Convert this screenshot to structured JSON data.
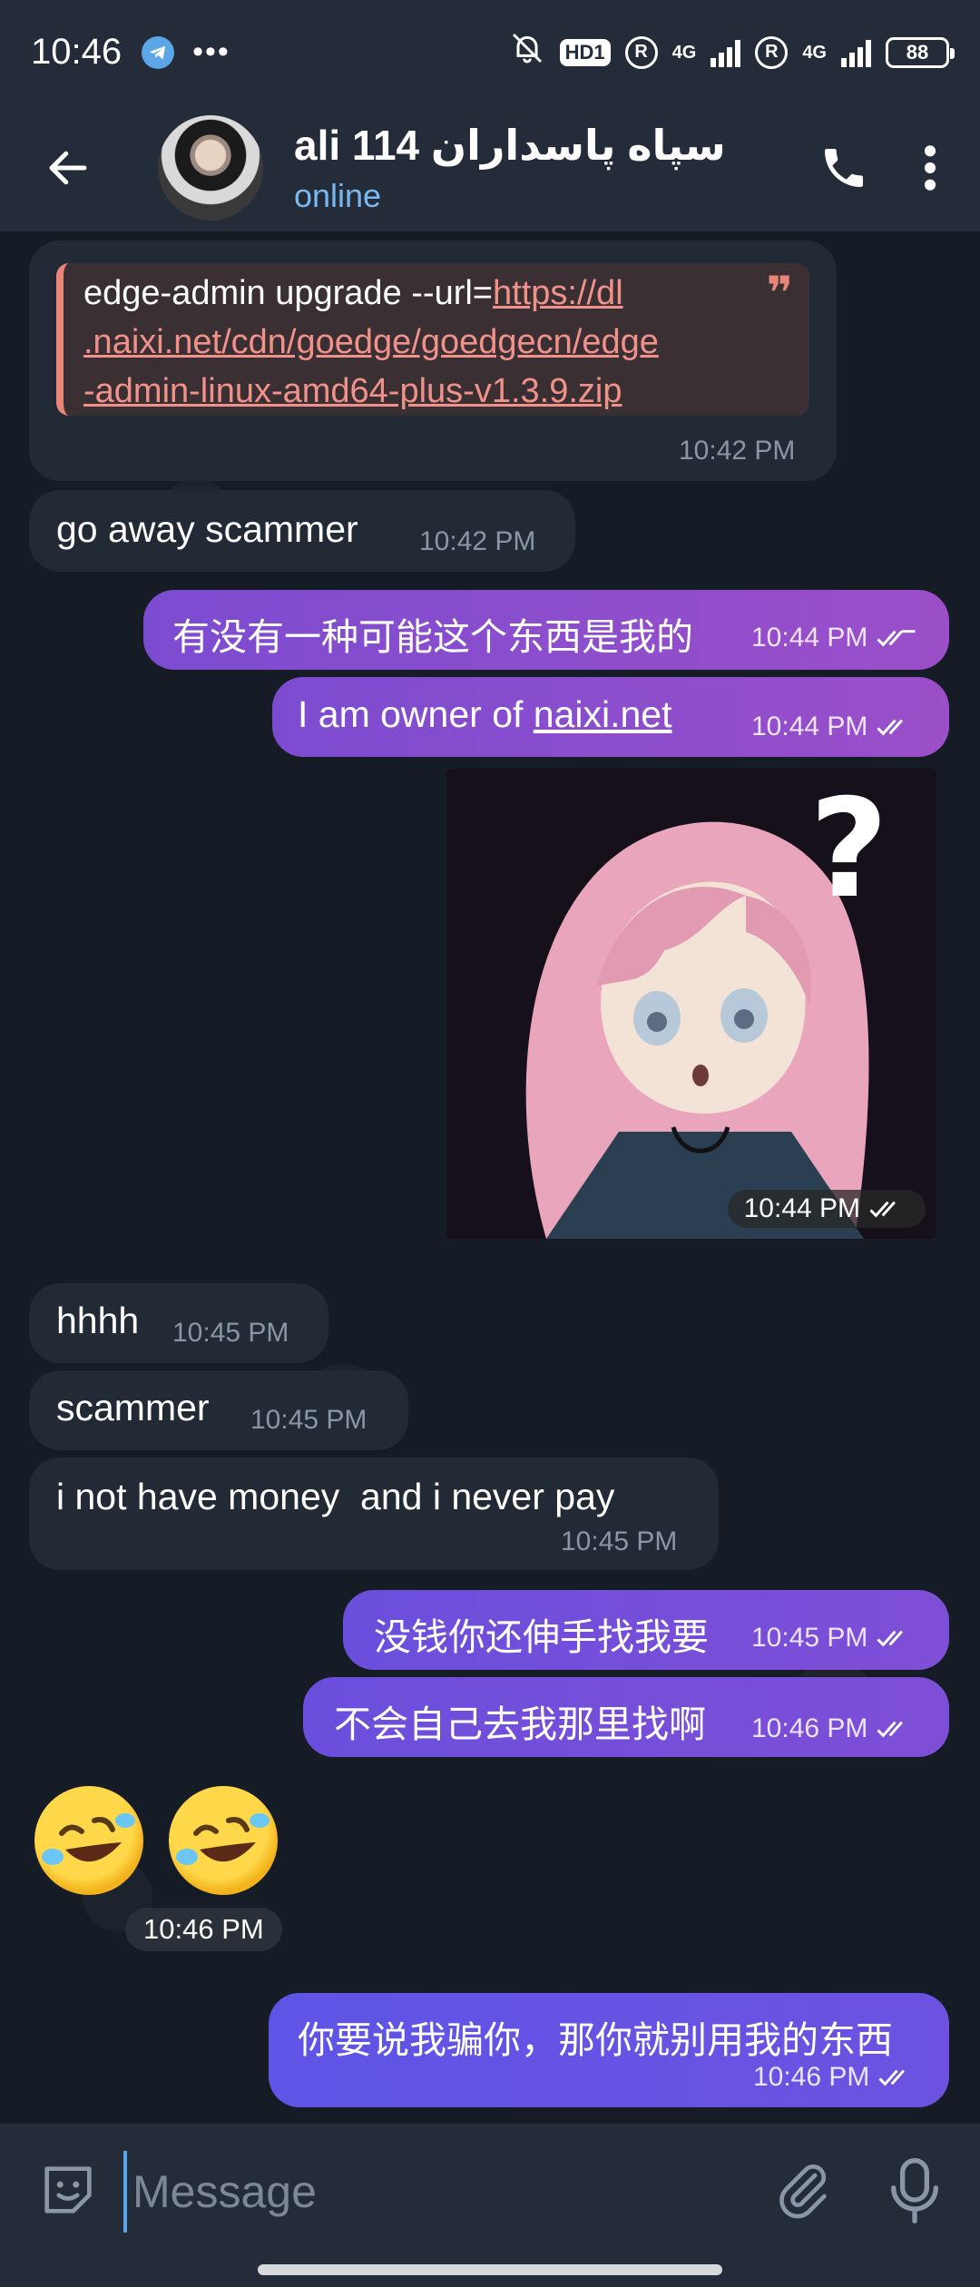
{
  "status_bar": {
    "time": "10:46",
    "hd_badge": "HD1",
    "net1": "4G",
    "net2": "4G",
    "battery": "88"
  },
  "header": {
    "title": "ali 114 سپاه پاسداران",
    "status": "online"
  },
  "messages": [
    {
      "quote_prefix": "edge-admin upgrade --url=",
      "quote_link_1": "https://dl",
      "quote_link_2": ".naixi.net/cdn/goedge/goedgecn/edge",
      "quote_link_3": "-admin-linux-amd64-plus-v1.3.9.zip",
      "time": "10:42 PM"
    },
    {
      "text": "go away scammer",
      "time": "10:42 PM"
    },
    {
      "text": "有没有一种可能这个东西是我的",
      "time": "10:44 PM"
    },
    {
      "text_prefix": "I am owner of ",
      "link": "naixi.net",
      "time": "10:44 PM"
    },
    {
      "sticker": "confused-anime-girl",
      "time": "10:44 PM"
    },
    {
      "text": "hhhh",
      "time": "10:45 PM"
    },
    {
      "text": "scammer",
      "time": "10:45 PM"
    },
    {
      "text": "i not have money  and i never pay",
      "time": "10:45 PM"
    },
    {
      "text": "没钱你还伸手找我要",
      "time": "10:45 PM"
    },
    {
      "text": "不会自己去我那里找啊",
      "time": "10:46 PM"
    },
    {
      "emoji": "rolling-on-floor-laughing",
      "time": "10:46 PM"
    },
    {
      "text": "你要说我骗你，那你就别用我的东西",
      "time": "10:46 PM"
    }
  ],
  "input": {
    "placeholder": "Message"
  }
}
